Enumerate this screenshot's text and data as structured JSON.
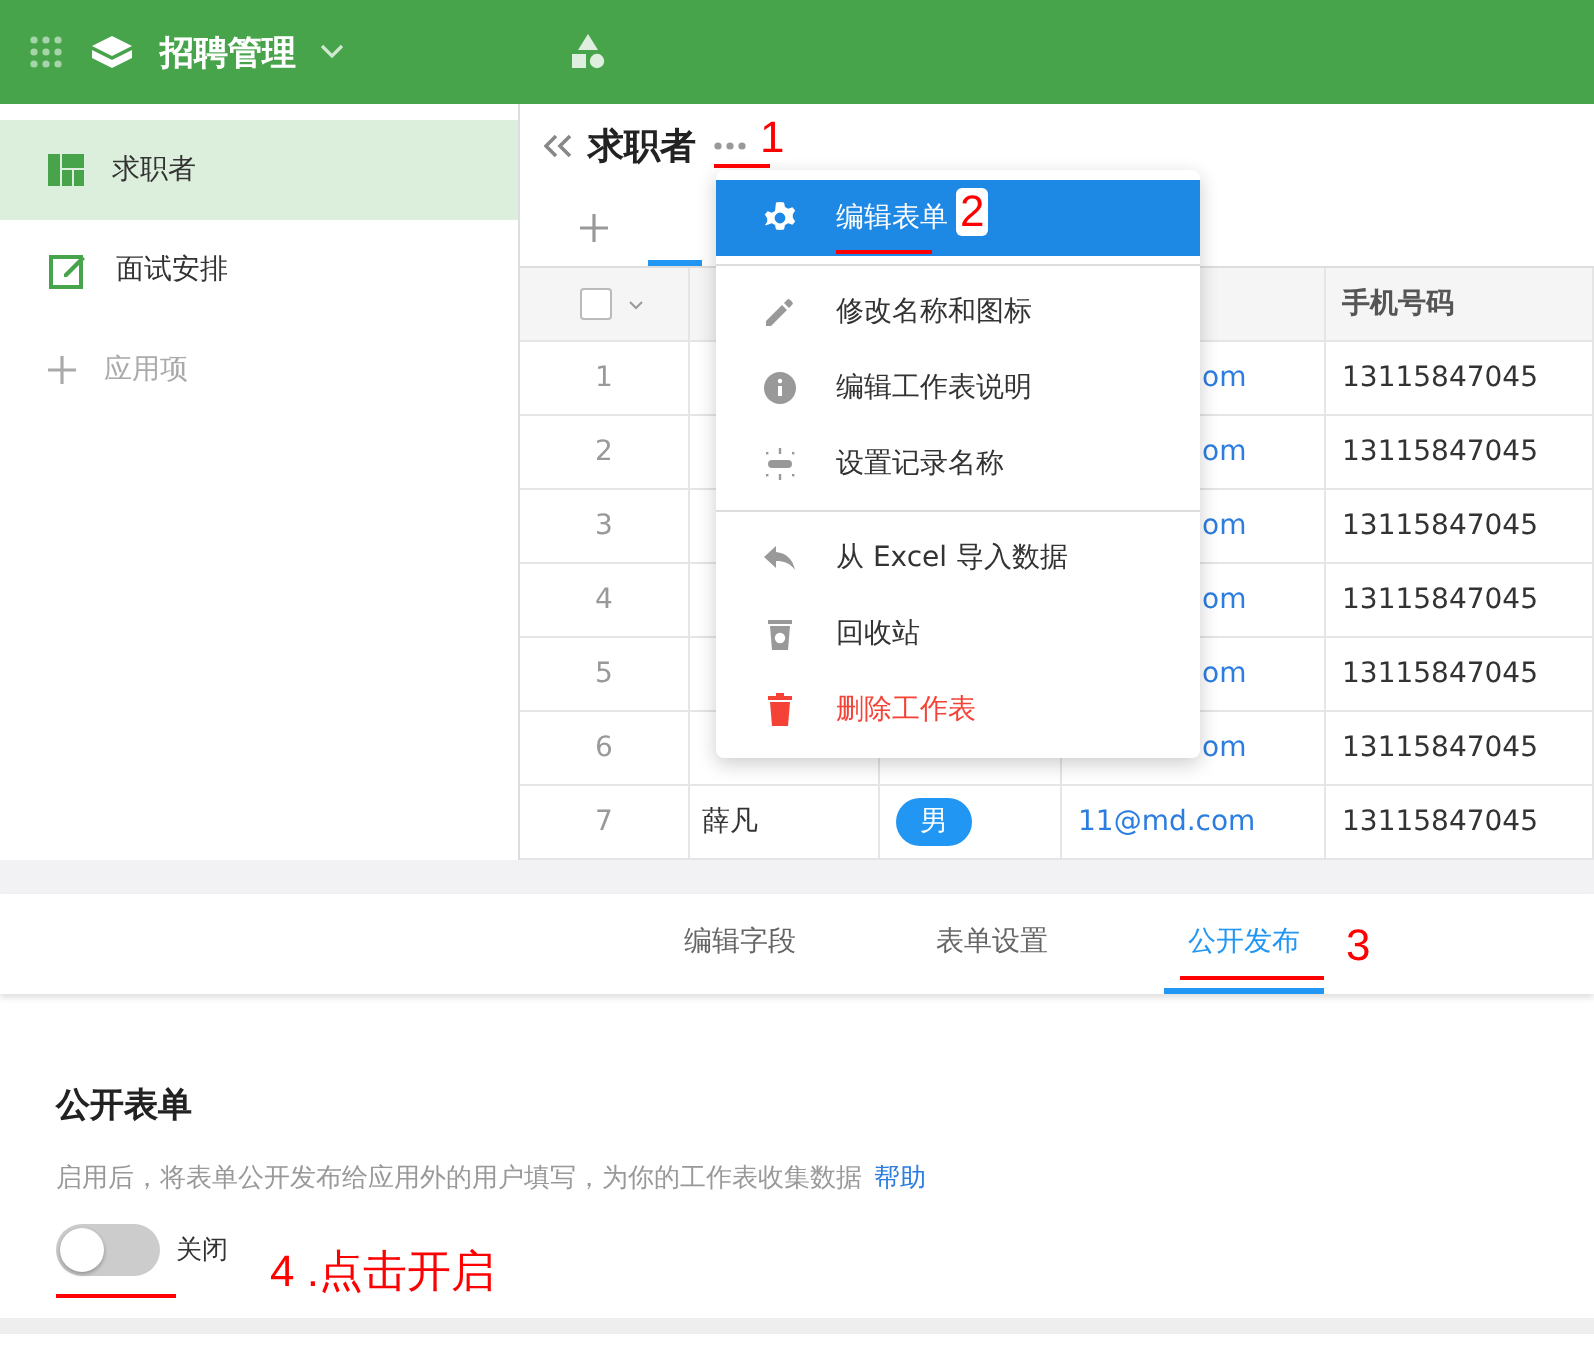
{
  "app": {
    "title": "招聘管理"
  },
  "sidebar": {
    "items": [
      {
        "label": "求职者",
        "selected": true,
        "kind": "sheet"
      },
      {
        "label": "面试安排",
        "selected": false,
        "kind": "custom"
      }
    ],
    "add_label": "应用项"
  },
  "sheet": {
    "title": "求职者",
    "phone_header": "手机号码",
    "select_all": {
      "checked": false
    },
    "rows": [
      {
        "number": "1",
        "email": "om",
        "phone": "13115847045"
      },
      {
        "number": "2",
        "email": "om",
        "phone": "13115847045"
      },
      {
        "number": "3",
        "email": "om",
        "phone": "13115847045"
      },
      {
        "number": "4",
        "email": "om",
        "phone": "13115847045"
      },
      {
        "number": "5",
        "email": "om",
        "phone": "13115847045"
      },
      {
        "number": "6",
        "email": "om",
        "phone": "13115847045"
      },
      {
        "number": "7",
        "name": "薛凡",
        "gender": "男",
        "email": "11@md.com",
        "phone": "13115847045"
      }
    ]
  },
  "menu": {
    "groups": [
      [
        {
          "label": "编辑表单",
          "kind": "gear",
          "selected": true
        }
      ],
      [
        {
          "label": "修改名称和图标",
          "kind": "pencil",
          "selected": false
        },
        {
          "label": "编辑工作表说明",
          "kind": "info",
          "selected": false
        },
        {
          "label": "设置记录名称",
          "kind": "record",
          "selected": false
        }
      ],
      [
        {
          "label": "从 Excel 导入数据",
          "kind": "import",
          "selected": false
        },
        {
          "label": "回收站",
          "kind": "recycle",
          "selected": false
        },
        {
          "label": "删除工作表",
          "kind": "delete",
          "selected": false
        }
      ]
    ]
  },
  "form_tabs": [
    {
      "label": "编辑字段",
      "selected": false
    },
    {
      "label": "表单设置",
      "selected": false
    },
    {
      "label": "公开发布",
      "selected": true
    }
  ],
  "public_form": {
    "title": "公开表单",
    "description": "启用后，将表单公开发布给应用外的用户填写，为你的工作表收集数据",
    "help_link": "帮助",
    "toggle": {
      "on": false,
      "label": "关闭"
    }
  },
  "annotations": [
    "1",
    "2",
    "3",
    "4 .点击开启"
  ]
}
